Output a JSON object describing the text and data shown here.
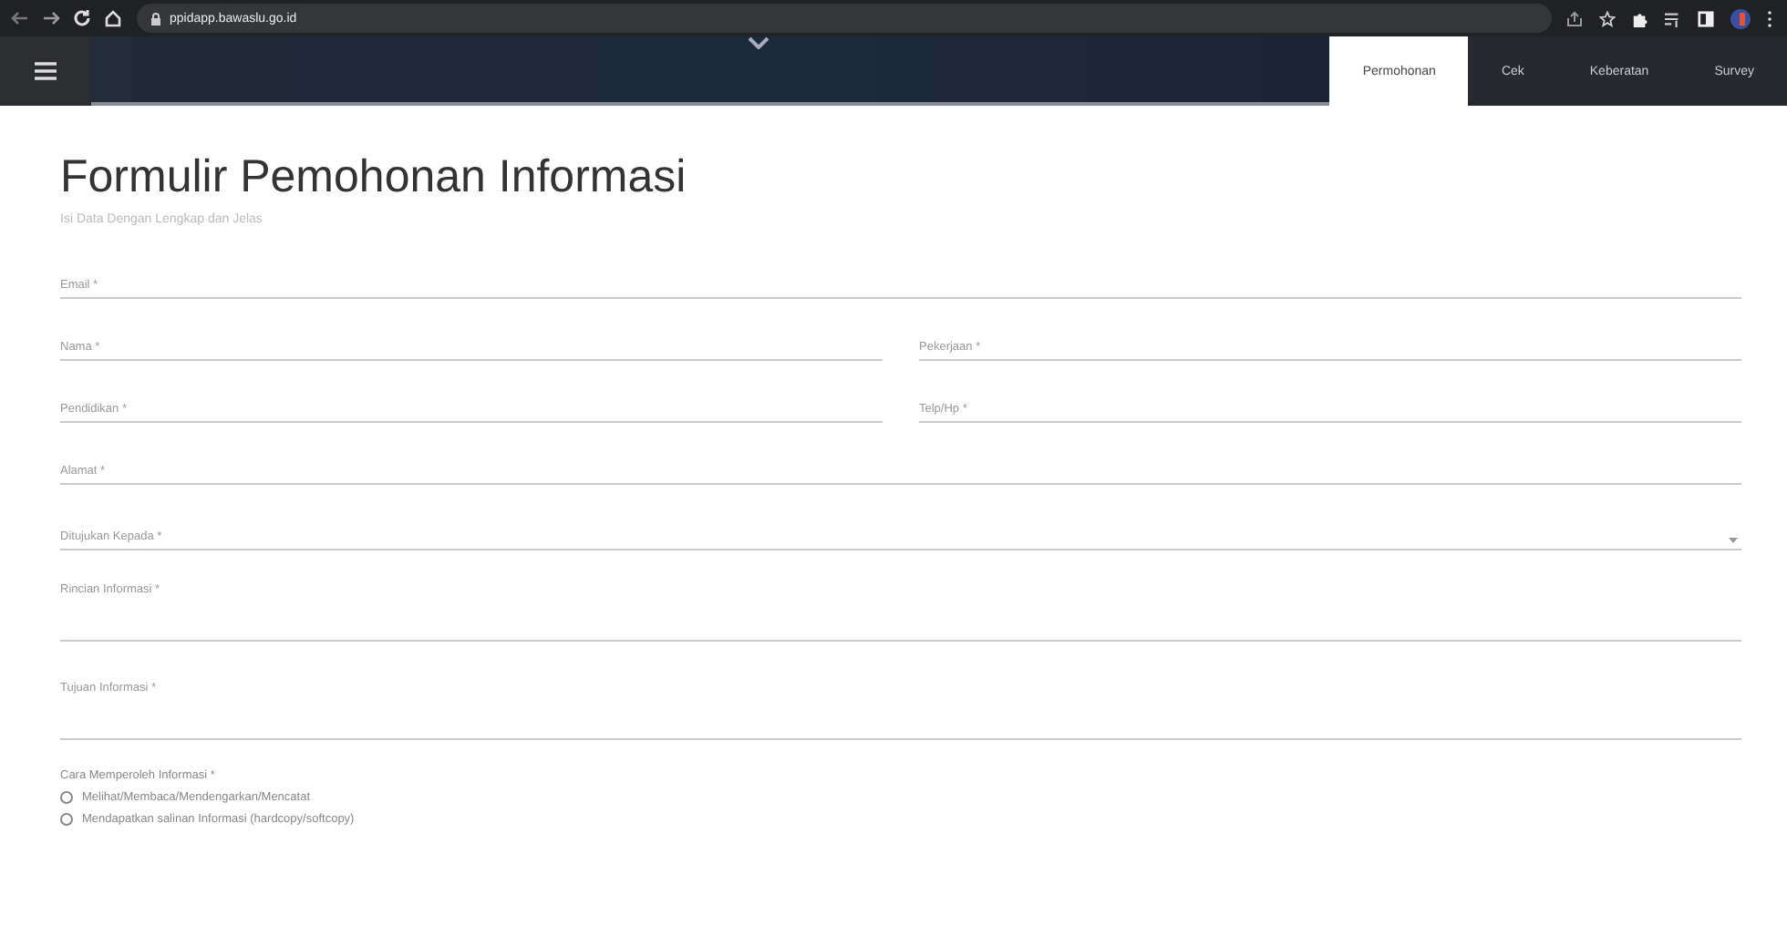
{
  "browser": {
    "url": "ppidapp.bawaslu.go.id"
  },
  "nav": {
    "tabs": [
      {
        "label": "Permohonan",
        "selected": true
      },
      {
        "label": "Cek",
        "selected": false
      },
      {
        "label": "Keberatan",
        "selected": false
      },
      {
        "label": "Survey",
        "selected": false
      }
    ]
  },
  "form": {
    "title": "Formulir Pemohonan Informasi",
    "subtitle": "Isi Data Dengan Lengkap dan Jelas",
    "rows": [
      [
        {
          "label": "Email *",
          "kind": "text"
        }
      ],
      [
        {
          "label": "Nama *",
          "kind": "text"
        },
        {
          "label": "Pekerjaan *",
          "kind": "text"
        }
      ],
      [
        {
          "label": "Pendidikan *",
          "kind": "text"
        },
        {
          "label": "Telp/Hp *",
          "kind": "text"
        }
      ],
      [
        {
          "label": "Alamat *",
          "kind": "text"
        }
      ],
      [
        {
          "label": "Ditujukan Kepada *",
          "kind": "select"
        }
      ],
      [
        {
          "label": "Rincian Informasi *",
          "kind": "textarea"
        }
      ],
      [
        {
          "label": "Tujuan Informasi *",
          "kind": "textarea"
        }
      ]
    ],
    "radio_group": {
      "label": "Cara Memperoleh Informasi *",
      "options": [
        {
          "label": "Melihat/Membaca/Mendengarkan/Mencatat",
          "selected": false
        },
        {
          "label": "Mendapatkan salinan Informasi (hardcopy/softcopy)",
          "selected": false
        }
      ]
    }
  }
}
